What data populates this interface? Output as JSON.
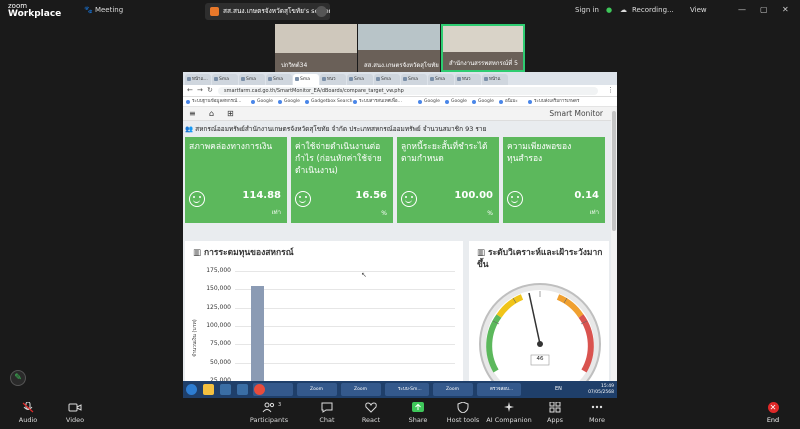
{
  "zoom_top": {
    "logo_line1": "zoom",
    "logo_line2": "Workplace",
    "meeting_label": "Meeting",
    "share_title": "สส.สนง.เกษตรจังหวัดสุโขทัย's screen",
    "share_initial": "ส",
    "sign_in": "Sign in",
    "recording": "Recording...",
    "view": "View"
  },
  "participants": [
    {
      "name": "ปกวิทต์34"
    },
    {
      "name": "สส.สนง.เกษตรจังหวัดสุโขทัย"
    },
    {
      "name": "สำนักงานสรรพสหกรณ์ที่ 5"
    }
  ],
  "browser": {
    "tabs": [
      "หน้าแ...",
      "Sma",
      "Sma",
      "Sma",
      "Sma",
      "หนว",
      "Sma",
      "Sma",
      "Sma",
      "Sma",
      "หนว",
      "หน้าแ"
    ],
    "url": "smartfarm.cad.go.th/SmartMonitor_EA/dBoards/compare_target_vw.php",
    "bookmarks": [
      "ระบบฐานข้อมูลสหกรณ์...",
      "Google",
      "Google",
      "Gadgetbox Search",
      "ระบบสารสนเทศเพื่อ...",
      "Google",
      "Google",
      "Google",
      "อนิเมะ",
      "ระบบส่งเสริมการเกษตร"
    ]
  },
  "app": {
    "brand": "Smart Monitor",
    "coop_line": "สหกรณ์ออมทรัพย์สำนักงานเกษตรจังหวัดสุโขทัย จำกัด ประเภทสหกรณ์ออมทรัพย์ จำนวนสมาชิก 93 ราย",
    "cards": [
      {
        "title": "สภาพคล่องทางการเงิน",
        "value": "114.88",
        "unit": "เท่า"
      },
      {
        "title": "ค่าใช้จ่ายดำเนินงานต่อกำไร (ก่อนหักค่าใช้จ่ายดำเนินงาน)",
        "value": "16.56",
        "unit": "%"
      },
      {
        "title": "ลูกหนี้ระยะสั้นที่ชำระได้ตามกำหนด",
        "value": "100.00",
        "unit": "%"
      },
      {
        "title": "ความเพียงพอของทุนสำรอง",
        "value": "0.14",
        "unit": "เท่า"
      }
    ],
    "capital_panel_title": "การระดมทุนของสหกรณ์",
    "risk_panel_title": "ระดับวิเคราะห์และเฝ้าระวังมากขึ้น",
    "gauge_value": "46"
  },
  "chart_data": {
    "type": "bar",
    "title": "การระดมทุนของสหกรณ์",
    "ylabel": "จำนวนเงิน (บาท)",
    "ylim": [
      25000,
      175000
    ],
    "yticks": [
      "175,000",
      "150,000",
      "125,000",
      "100,000",
      "75,000",
      "50,000",
      "25,000"
    ],
    "values": [
      154000
    ]
  },
  "taskbar": {
    "time": "15:49",
    "date": "07/05/2568",
    "lang": "EN",
    "items": [
      "",
      "",
      "",
      "Zoom",
      "Zoom",
      "ระบบ-Sm...",
      "Zoom",
      "ตรวจสอบ..."
    ]
  },
  "zoom_bottom": {
    "audio": "Audio",
    "video": "Video",
    "participants": "Participants",
    "participants_count": "3",
    "chat": "Chat",
    "react": "React",
    "share": "Share",
    "host_tools": "Host tools",
    "ai_companion": "AI Companion",
    "apps": "Apps",
    "more": "More",
    "end": "End"
  },
  "colors": {
    "card_green": "#5cb85c",
    "zoom_bg": "#1a1a1a",
    "bar_color": "#8b9bb4",
    "end_red": "#e02828"
  }
}
